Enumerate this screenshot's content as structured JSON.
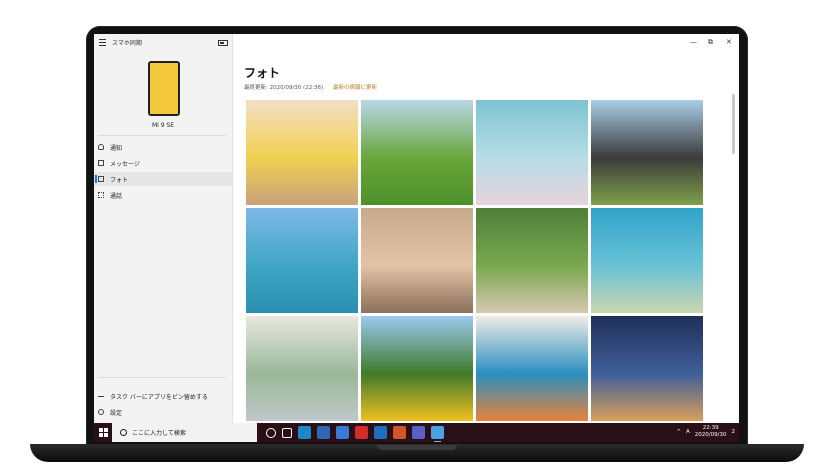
{
  "app": {
    "title": "スマホ同期"
  },
  "device": {
    "name": "Mi 9 SE"
  },
  "nav": [
    {
      "label": "通知",
      "icon": "bell-icon"
    },
    {
      "label": "メッセージ",
      "icon": "message-icon"
    },
    {
      "label": "フォト",
      "icon": "photo-icon",
      "active": true
    },
    {
      "label": "通話",
      "icon": "phone-dialpad-icon"
    }
  ],
  "sidebar_bottom": [
    {
      "label": "タスク バーにアプリをピン留めする",
      "icon": "pin-icon"
    },
    {
      "label": "設定",
      "icon": "gear-icon"
    }
  ],
  "main": {
    "title": "フォト",
    "last_updated": "最終更新: 2020/09/30 (22:36)",
    "refresh_link": "最新の情報に更新"
  },
  "window_controls": [
    "—",
    "⧉",
    "✕"
  ],
  "photos": [
    {
      "name": "photo-girl-eating",
      "colors": [
        "#f3dfc7",
        "#f0d050",
        "#c9a27c"
      ]
    },
    {
      "name": "photo-child-running-grass",
      "colors": [
        "#b9d7e9",
        "#6aa63a",
        "#4f8f2a"
      ]
    },
    {
      "name": "photo-cherry-blossoms",
      "colors": [
        "#7fc3d3",
        "#b6dde5",
        "#e7d3db"
      ]
    },
    {
      "name": "photo-family-car-trunk",
      "colors": [
        "#a9cde7",
        "#3b3b3b",
        "#7fa04a"
      ]
    },
    {
      "name": "photo-ocean-sky",
      "colors": [
        "#7fb8e8",
        "#3fa6c7",
        "#2a8fb0"
      ]
    },
    {
      "name": "photo-smiling-children",
      "colors": [
        "#c7a98c",
        "#e4c3a6",
        "#8a6f5a"
      ]
    },
    {
      "name": "photo-dog-ball",
      "colors": [
        "#4f7f3a",
        "#7aa84f",
        "#d7c7b0"
      ]
    },
    {
      "name": "photo-sea-turtle",
      "colors": [
        "#2fa3c9",
        "#69c2d6",
        "#c9d7b0"
      ]
    },
    {
      "name": "photo-girl-bubbles",
      "colors": [
        "#e8e8e0",
        "#9ab89a",
        "#c0c8c8"
      ]
    },
    {
      "name": "photo-sunflowers",
      "colors": [
        "#9cc9ef",
        "#3f7a2a",
        "#f0c020"
      ]
    },
    {
      "name": "photo-children-drawing",
      "colors": [
        "#f0ece6",
        "#2b8fc0",
        "#e8823a"
      ]
    },
    {
      "name": "photo-city-night-tower",
      "colors": [
        "#1f2f58",
        "#3f5f9a",
        "#d8a05a"
      ]
    }
  ],
  "taskbar": {
    "search_placeholder": "ここに入力して検索",
    "apps": [
      {
        "icon": "cortana-icon",
        "color": "#2b0f16"
      },
      {
        "icon": "task-view-icon",
        "color": "#2b0f16"
      },
      {
        "icon": "edge-icon",
        "color": "#1e88c7"
      },
      {
        "icon": "store-icon",
        "color": "#2f66b5"
      },
      {
        "icon": "mail-icon",
        "color": "#3a7bd5"
      },
      {
        "icon": "acrobat-icon",
        "color": "#d62b2b"
      },
      {
        "icon": "outlook-icon",
        "color": "#1f6fc0"
      },
      {
        "icon": "powerpoint-icon",
        "color": "#d1562b"
      },
      {
        "icon": "teams-icon",
        "color": "#5b5fc7"
      },
      {
        "icon": "your-phone-icon",
        "color": "#4aa3e0",
        "active": true
      }
    ],
    "tray": {
      "ime": "A",
      "time": "22:39",
      "date": "2020/09/30",
      "notifications": "2"
    }
  }
}
